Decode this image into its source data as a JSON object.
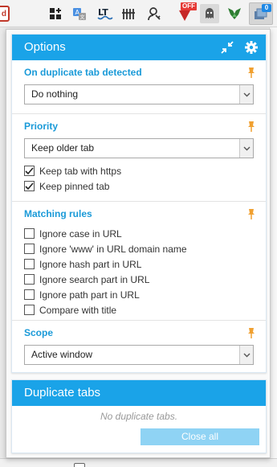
{
  "toolbar": {
    "extensions": [
      {
        "name": "addon-icon"
      },
      {
        "name": "translate-icon"
      },
      {
        "name": "languagetool-icon",
        "label": "LT"
      },
      {
        "name": "bars-icon"
      },
      {
        "name": "user-key-icon"
      },
      {
        "name": "off-extension-icon",
        "badge": "OFF"
      },
      {
        "name": "ghostery-icon"
      },
      {
        "name": "gem-icon"
      },
      {
        "name": "duplicate-tabs-icon",
        "badge": "0"
      }
    ],
    "left_edge_glyph": "d"
  },
  "options": {
    "title": "Options",
    "sections": {
      "on_duplicate": {
        "title": "On duplicate tab detected",
        "selected": "Do nothing"
      },
      "priority": {
        "title": "Priority",
        "selected": "Keep older tab",
        "checkboxes": [
          {
            "label": "Keep tab with https",
            "checked": true
          },
          {
            "label": "Keep pinned tab",
            "checked": true
          }
        ]
      },
      "matching": {
        "title": "Matching rules",
        "checkboxes": [
          {
            "label": "Ignore case in URL",
            "checked": false
          },
          {
            "label": "Ignore 'www' in URL domain name",
            "checked": false
          },
          {
            "label": "Ignore hash part in URL",
            "checked": false
          },
          {
            "label": "Ignore search part in URL",
            "checked": false
          },
          {
            "label": "Ignore path part in URL",
            "checked": false
          },
          {
            "label": "Compare with title",
            "checked": false
          }
        ]
      },
      "scope": {
        "title": "Scope",
        "selected": "Active window"
      }
    }
  },
  "duplicates": {
    "title": "Duplicate tabs",
    "empty_message": "No duplicate tabs.",
    "close_all_label": "Close all"
  },
  "colors": {
    "accent": "#1aa3e8",
    "section_title": "#1a9ad8",
    "pin": "#f0a030",
    "close_all_disabled": "#8fd3f4"
  }
}
